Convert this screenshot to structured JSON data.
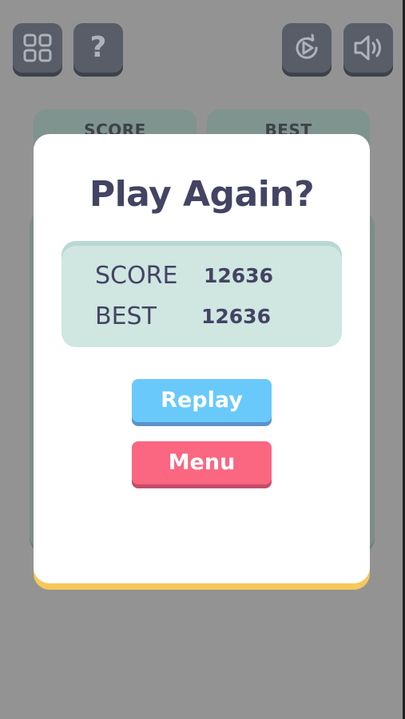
{
  "top_bar": {
    "help_label": "?"
  },
  "background": {
    "score_label": "SCORE",
    "best_label": "BEST"
  },
  "dialog": {
    "title": "Play Again?",
    "score_label": "SCORE",
    "score_value": "12636",
    "best_label": "BEST",
    "best_value": "12636",
    "replay_label": "Replay",
    "menu_label": "Menu"
  },
  "colors": {
    "replay_button": "#69c9fb",
    "menu_button": "#fb6681",
    "dialog_accent": "#f6c85a",
    "title_text": "#434463",
    "score_box": "#cfe6e1"
  },
  "icons": {
    "top_left": [
      "grid-menu-icon",
      "help-icon"
    ],
    "top_right": [
      "restart-icon",
      "sound-icon"
    ]
  }
}
